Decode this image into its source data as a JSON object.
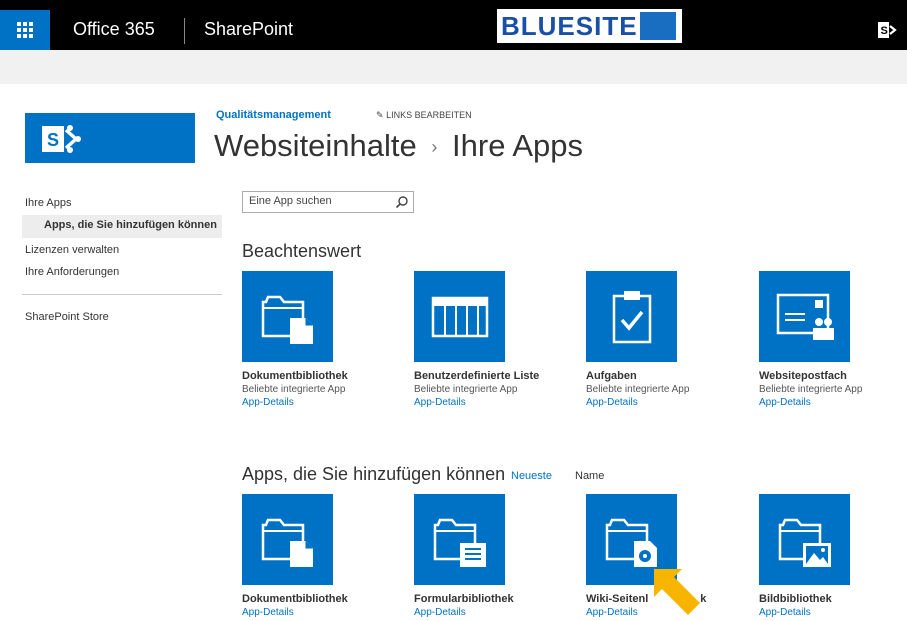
{
  "suitebar": {
    "office_label": "Office 365",
    "app_label": "SharePoint",
    "brand_text": "BLUESITE",
    "bg_color": "#000000",
    "accent_color": "#0072c6"
  },
  "header": {
    "site_link": "Qualitätsmanagement",
    "edit_links": "LINKS BEARBEITEN",
    "title_part1": "Websiteinhalte",
    "title_sep": "›",
    "title_part2": "Ihre Apps"
  },
  "leftnav": {
    "items": [
      {
        "label": "Ihre Apps"
      },
      {
        "label": "Apps, die Sie hinzufügen können"
      },
      {
        "label": "Lizenzen verwalten"
      },
      {
        "label": "Ihre Anforderungen"
      },
      {
        "label": "SharePoint Store"
      }
    ]
  },
  "search": {
    "placeholder": "Eine App suchen"
  },
  "noteworthy": {
    "title": "Beachtenswert",
    "tiles": [
      {
        "name": "Dokumentbibliothek",
        "subtitle": "Beliebte integrierte App",
        "link": "App-Details",
        "icon": "document-library-icon"
      },
      {
        "name": "Benutzerdefinierte Liste",
        "subtitle": "Beliebte integrierte App",
        "link": "App-Details",
        "icon": "custom-list-icon"
      },
      {
        "name": "Aufgaben",
        "subtitle": "Beliebte integrierte App",
        "link": "App-Details",
        "icon": "tasks-icon"
      },
      {
        "name": "Websitepostfach",
        "subtitle": "Beliebte integrierte App",
        "link": "App-Details",
        "icon": "site-mailbox-icon"
      }
    ]
  },
  "addable": {
    "title": "Apps, die Sie hinzufügen können",
    "sort_newest": "Neueste",
    "sort_name": "Name",
    "tiles": [
      {
        "name": "Dokumentbibliothek",
        "link": "App-Details",
        "icon": "document-library-icon"
      },
      {
        "name": "Formularbibliothek",
        "link": "App-Details",
        "icon": "form-library-icon"
      },
      {
        "name": "Wiki-Seitenbibliothek",
        "visible_name": "Wiki-Seitenl",
        "visible_name_tail": "k",
        "link": "App-Details",
        "icon": "wiki-library-icon"
      },
      {
        "name": "Bildbibliothek",
        "link": "App-Details",
        "icon": "picture-library-icon"
      }
    ]
  },
  "colors": {
    "tile_blue": "#0072c6",
    "link_blue": "#0072c6",
    "highlight_arrow": "#f7b500"
  }
}
